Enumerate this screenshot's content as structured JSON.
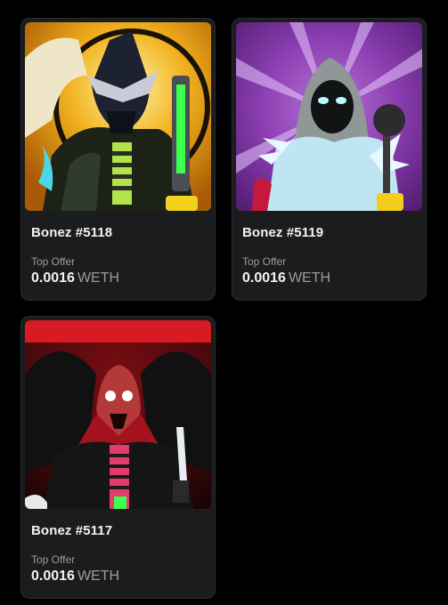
{
  "items": [
    {
      "name": "Bonez #5118",
      "offer_label": "Top Offer",
      "price": "0.0016",
      "currency": "WETH"
    },
    {
      "name": "Bonez #5119",
      "offer_label": "Top Offer",
      "price": "0.0016",
      "currency": "WETH"
    },
    {
      "name": "Bonez #5117",
      "offer_label": "Top Offer",
      "price": "0.0016",
      "currency": "WETH"
    }
  ],
  "colors": {
    "background": "#000000",
    "card": "#1b1c1e",
    "text": "#f2f2f2",
    "muted": "#9c9c9f"
  },
  "images": [
    {
      "subject": "dark-helmet-knight-with-green-sword"
    },
    {
      "subject": "hooded-ice-wraith-with-mace"
    },
    {
      "subject": "red-skeleton-vampire-with-knife"
    }
  ]
}
